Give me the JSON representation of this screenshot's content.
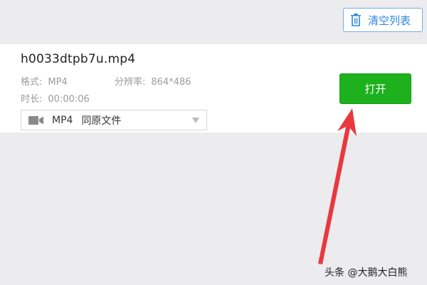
{
  "toolbar": {
    "clear_list_label": "清空列表",
    "clear_icon": "trash-icon",
    "accent_color": "#2b86de"
  },
  "file": {
    "name": "h0033dtpb7u.mp4",
    "format_label": "格式:",
    "format_value": "MP4",
    "resolution_label": "分辨率:",
    "resolution_value": "864*486",
    "duration_label": "时长:",
    "duration_value": "00:00:06",
    "output_format": "MP4",
    "output_option": "同原文件",
    "output_icon": "video-camera-icon",
    "open_label": "打开",
    "open_color": "#1db11d"
  },
  "annotation": {
    "arrow_color": "#e8393f"
  },
  "watermark": {
    "text": "头条 @大鹅大白熊"
  }
}
